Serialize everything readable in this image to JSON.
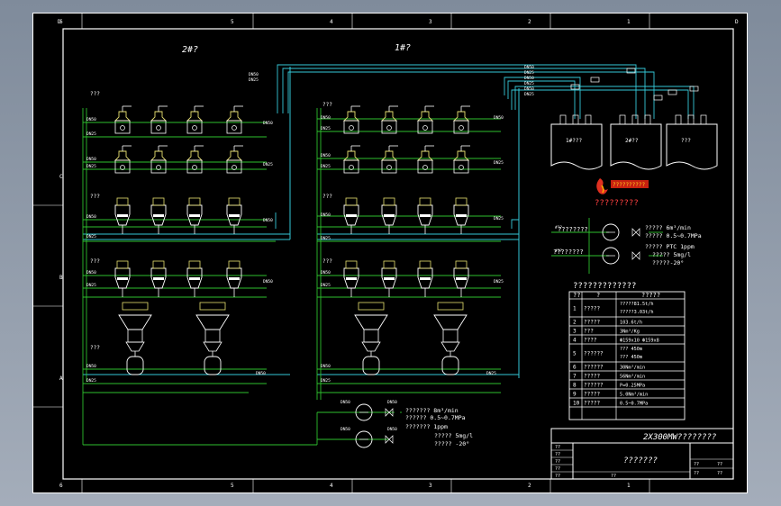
{
  "frame": {
    "col_top": [
      "6",
      "5",
      "4",
      "3",
      "2",
      "1"
    ],
    "col_bottom": [
      "6",
      "5",
      "4",
      "3",
      "2",
      "1"
    ],
    "corner_left": "D",
    "corner_right": "D",
    "row_left": [
      "C",
      "B",
      "A"
    ]
  },
  "units": {
    "left_title": "2#?",
    "right_title": "1#?"
  },
  "labels": {
    "row_tag": "???",
    "row_tag2": "???",
    "bottom_tag": "???",
    "dn_a": "DN50",
    "dn_b": "DN25",
    "ext": "#??",
    "silo_names": [
      "1#???",
      "2#??",
      "???"
    ],
    "logo_text": "??????????",
    "sec_title": "?????????"
  },
  "compressor_right": {
    "left_text": "????????",
    "specs": [
      "????? 6m³/min",
      "????? 0.5~0.7MPa",
      "????? PTC 1ppm",
      "????? 5mg/l",
      "?????-20°"
    ]
  },
  "compressor_bottom": {
    "specs": [
      "??????? 8m³/min",
      "?????? 0.5~0.7MPa",
      "??????? 1ppm",
      "????? 5mg/l",
      "????? -20°"
    ]
  },
  "table": {
    "title": "?????????????",
    "headers": [
      "??",
      "?",
      "?????"
    ],
    "rows": [
      {
        "n": "1",
        "name": "?????",
        "value": "?????81.5t/h",
        "value2": "?????3.03t/h"
      },
      {
        "n": "2",
        "name": "?????",
        "value": "103.6t/h"
      },
      {
        "n": "3",
        "name": "???",
        "value": "3Nm³/Kg"
      },
      {
        "n": "4",
        "name": "????",
        "value": "Ф159x10 Ф159x8"
      },
      {
        "n": "5",
        "name": "??????",
        "value": "???  450m",
        "value2": "???  450m"
      },
      {
        "n": "6",
        "name": "??????",
        "value": "30Nm³/min"
      },
      {
        "n": "7",
        "name": "?????",
        "value": "56Nm³/min"
      },
      {
        "n": "8",
        "name": "??????",
        "value": "P=0.25MPa"
      },
      {
        "n": "9",
        "name": "?????",
        "value": "5.0Nm³/min"
      },
      {
        "n": "10",
        "name": "?????",
        "value": "0.5~0.7MPa"
      }
    ]
  },
  "title_block": {
    "project": "2X300MW????????",
    "drawing": "???????",
    "cells": [
      "??",
      "??",
      "??",
      "??",
      "??",
      "??",
      "??",
      "??",
      "??"
    ],
    "scale": "??",
    "sheet": "??"
  },
  "colors": {
    "frame": "#ffffff",
    "pipe_green": "#2ec02e",
    "pipe_cyan": "#35c8d8",
    "equipment": "#ffffff",
    "valve_yellow": "#e8e070",
    "accent_red": "#e03020"
  }
}
